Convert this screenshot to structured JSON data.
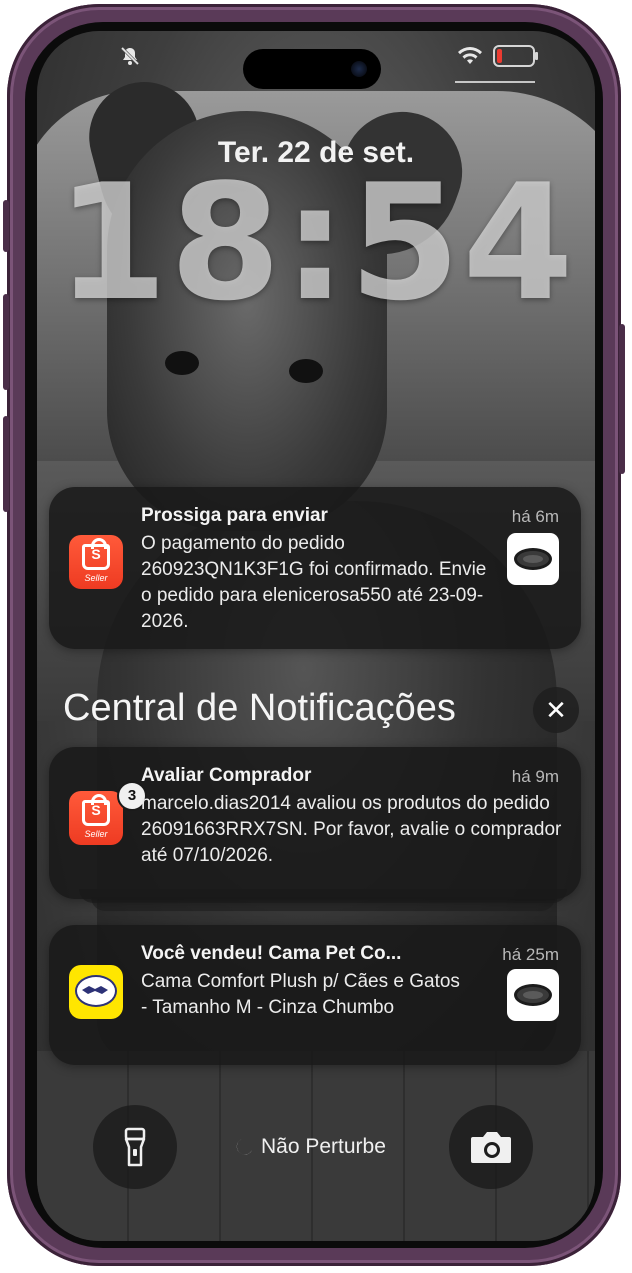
{
  "status_bar": {
    "bell_muted_icon": "bell-slash-icon",
    "wifi_icon": "wifi-icon",
    "battery_icon": "battery-low-icon",
    "battery_color": "#ff3b30"
  },
  "lock": {
    "date": "Ter. 22 de set.",
    "time": "18:54"
  },
  "notifications": [
    {
      "app": "Shopee Seller",
      "title": "Prossiga para enviar",
      "ago": "há 6m",
      "body": "O pagamento do pedido 260923QN1K3F1G foi confirmado. Envie o pedido para elenicerosa550 até 23-09-2026."
    }
  ],
  "center": {
    "title": "Central de Notificações",
    "close_symbol": "✕"
  },
  "center_notifications": [
    {
      "app": "Shopee Seller",
      "badge": "3",
      "title": "Avaliar Comprador",
      "ago": "há 9m",
      "body": "marcelo.dias2014 avaliou os produtos do pedido 26091663RRX7SN. Por favor, avalie o comprador até 07/10/2026."
    },
    {
      "app": "Mercado Livre",
      "title": "Você vendeu! Cama Pet Co...",
      "ago": "há 25m",
      "body": "Cama Comfort Plush p/ Cães e Gatos - Tamanho M - Cinza Chumbo"
    }
  ],
  "bottom": {
    "flashlight_icon": "flashlight-icon",
    "camera_icon": "camera-icon",
    "dnd_label": "Não Perturbe"
  },
  "app_icons": {
    "shopee_s": "S",
    "shopee_seller": "Seller"
  },
  "colors": {
    "shopee": "#ee4d2d",
    "mercadolivre": "#ffe600",
    "frame": "#5a3a58"
  }
}
